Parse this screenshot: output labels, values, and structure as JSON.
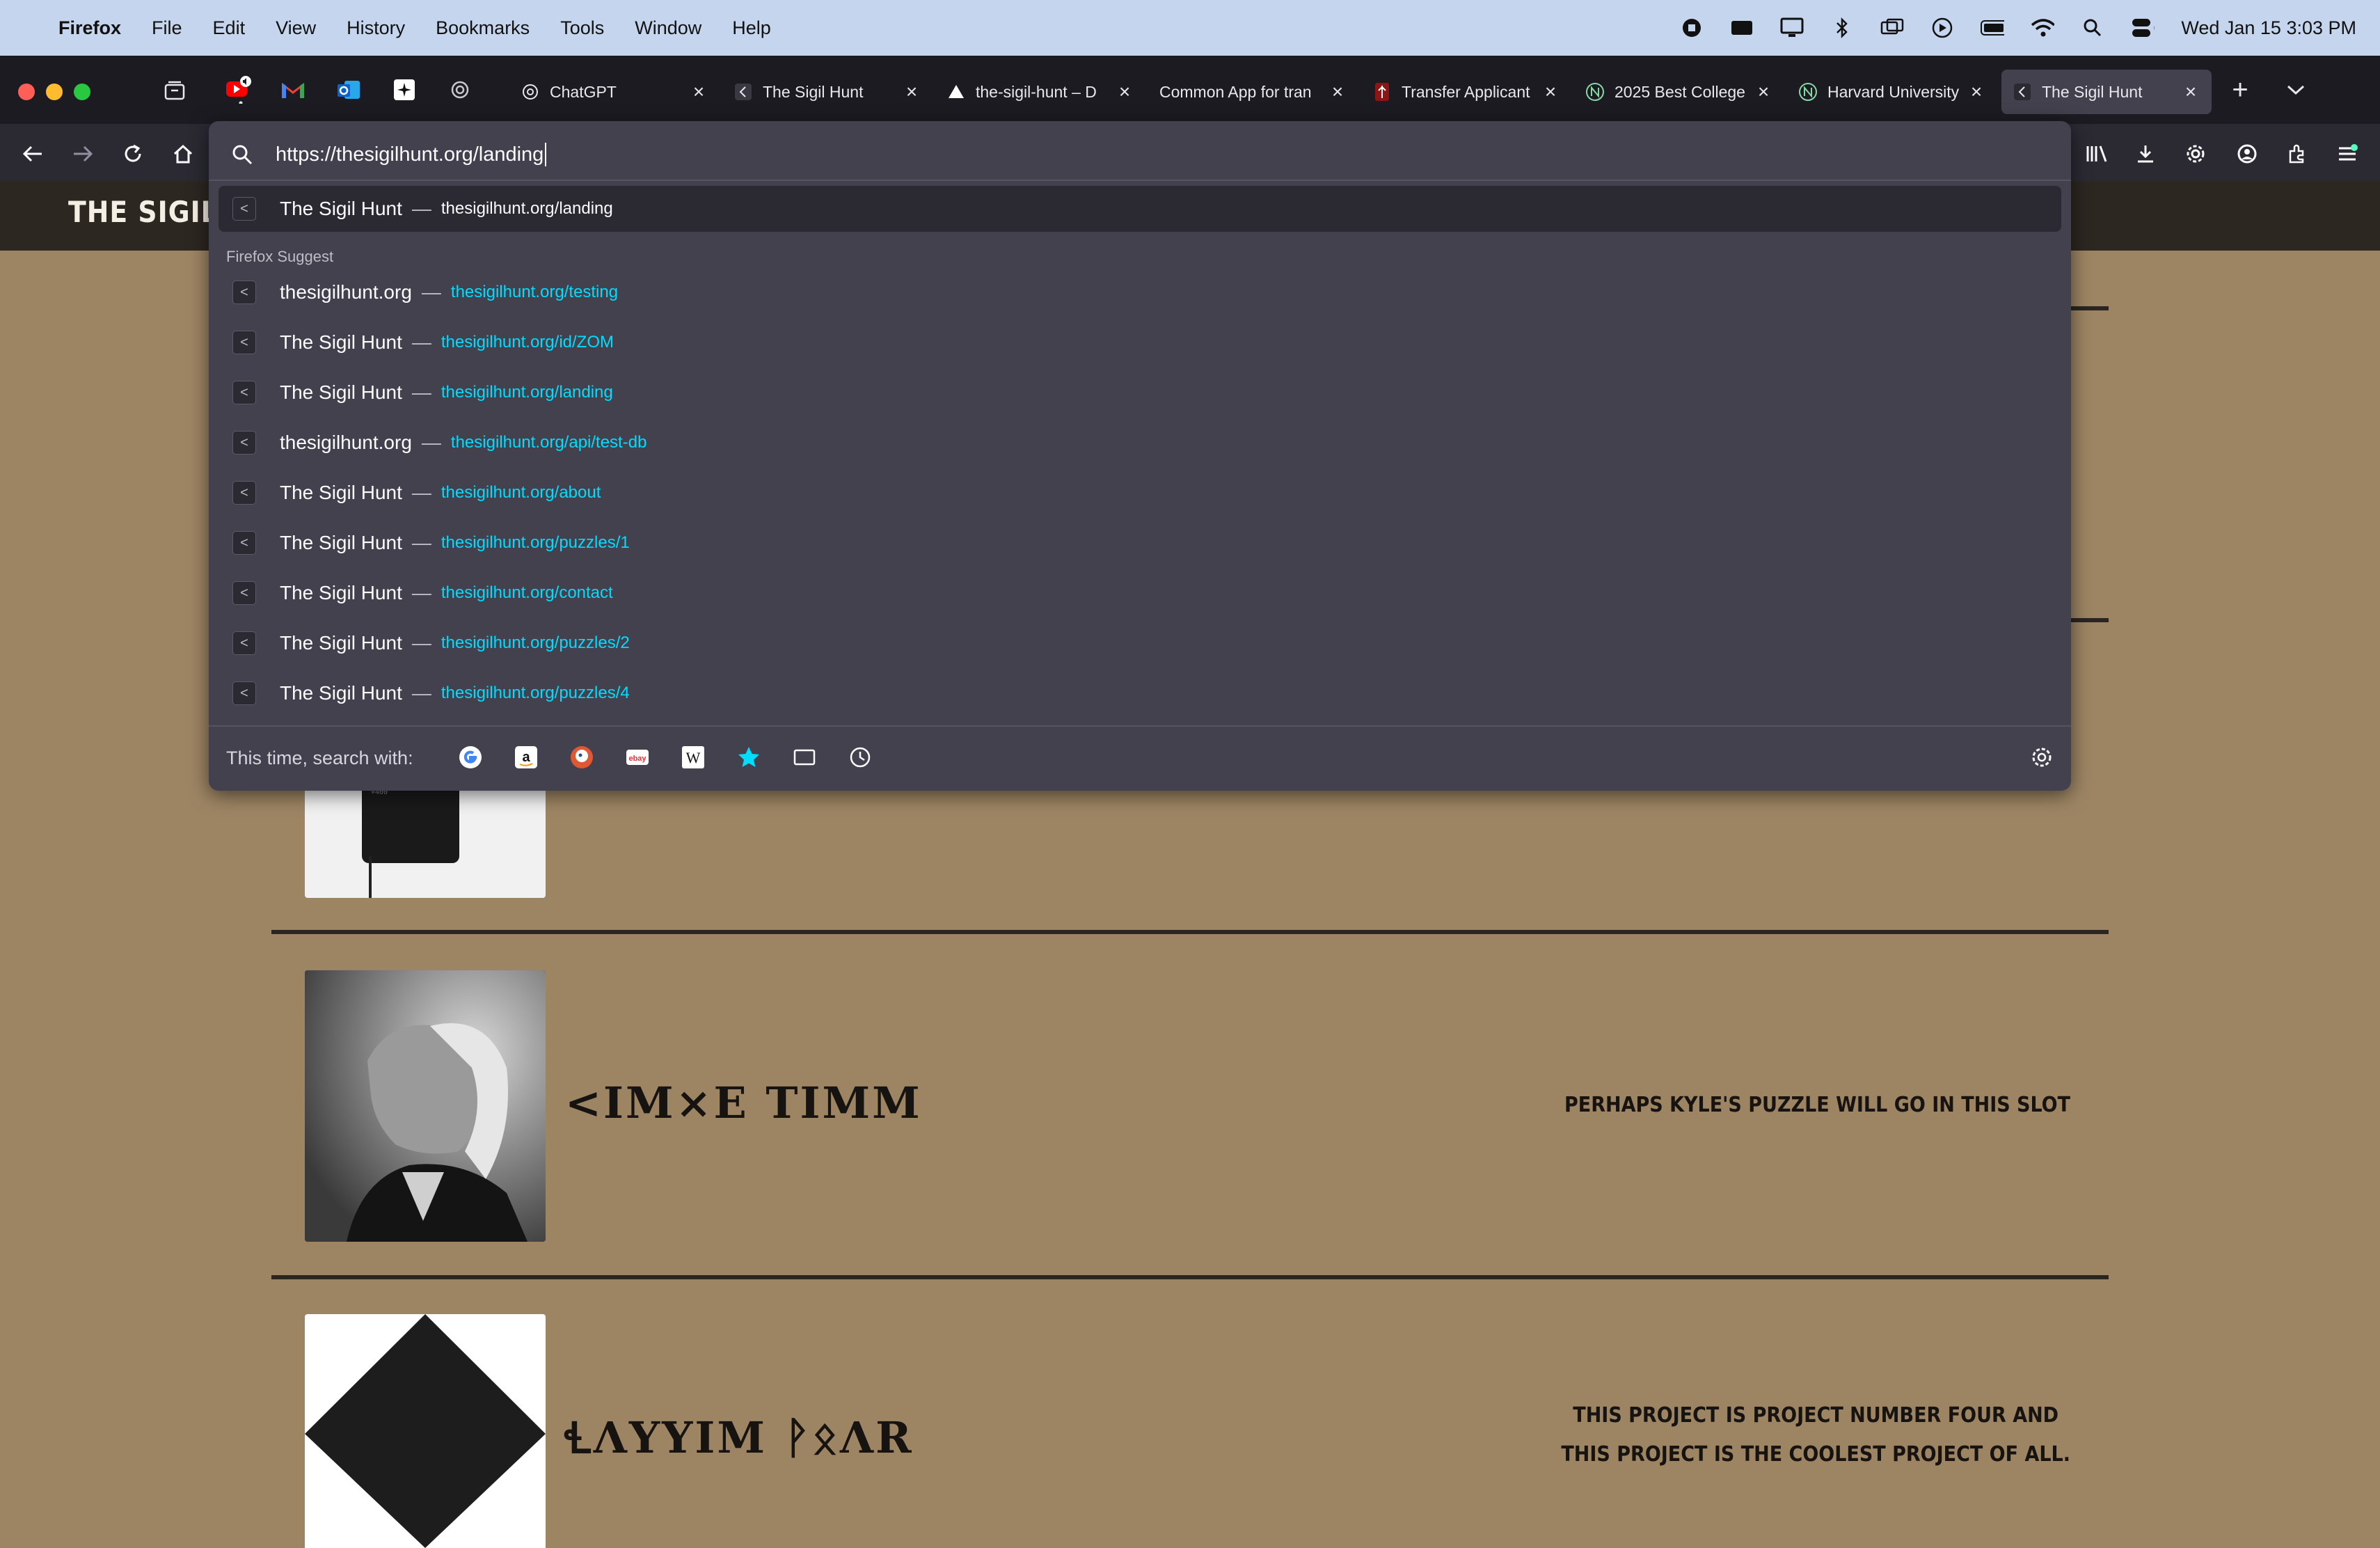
{
  "menubar": {
    "items": [
      "Firefox",
      "File",
      "Edit",
      "View",
      "History",
      "Bookmarks",
      "Tools",
      "Window",
      "Help"
    ],
    "clock": "Wed Jan 15  3:03 PM"
  },
  "tabs": [
    {
      "title": "ChatGPT",
      "icon": "chatgpt-icon"
    },
    {
      "title": "The Sigil Hunt",
      "icon": "sigil-icon"
    },
    {
      "title": "the-sigil-hunt – D",
      "icon": "vercel-icon"
    },
    {
      "title": "Common App for tran",
      "icon": "commonapp-icon"
    },
    {
      "title": "Transfer Applicant",
      "icon": "stanford-icon"
    },
    {
      "title": "2025 Best College",
      "icon": "niche-icon"
    },
    {
      "title": "Harvard University",
      "icon": "niche-icon"
    },
    {
      "title": "The Sigil Hunt",
      "icon": "sigil-icon"
    }
  ],
  "urlbar": {
    "value": "https://thesigilhunt.org/landing",
    "heuristic": {
      "title": "The Sigil Hunt",
      "url": "thesigilhunt.org/landing"
    },
    "section_label": "Firefox Suggest",
    "suggestions": [
      {
        "title": "thesigilhunt.org",
        "url": "thesigilhunt.org/testing"
      },
      {
        "title": "The Sigil Hunt",
        "url": "thesigilhunt.org/id/ZOM"
      },
      {
        "title": "The Sigil Hunt",
        "url": "thesigilhunt.org/landing"
      },
      {
        "title": "thesigilhunt.org",
        "url": "thesigilhunt.org/api/test-db"
      },
      {
        "title": "The Sigil Hunt",
        "url": "thesigilhunt.org/about"
      },
      {
        "title": "The Sigil Hunt",
        "url": "thesigilhunt.org/puzzles/1"
      },
      {
        "title": "The Sigil Hunt",
        "url": "thesigilhunt.org/contact"
      },
      {
        "title": "The Sigil Hunt",
        "url": "thesigilhunt.org/puzzles/2"
      },
      {
        "title": "The Sigil Hunt",
        "url": "thesigilhunt.org/puzzles/4"
      }
    ],
    "oneoff_label": "This time, search with:",
    "engines": [
      "google-icon",
      "amazon-icon",
      "duckduckgo-icon",
      "ebay-icon",
      "wikipedia-icon",
      "bookmarks-icon",
      "tabs-icon",
      "history-icon"
    ],
    "dash": "—"
  },
  "site": {
    "logo": "THE SIGIL HUI",
    "rows": [
      {
        "name": "<IM×E TIMM",
        "desc_lines": [
          "PERHAPS KYLE'S PUZZLE WILL GO IN THIS SLOT"
        ]
      },
      {
        "name": "ꞭΛYYIM ᚹᛟΛR",
        "desc_lines": [
          "THIS PROJECT IS PROJECT NUMBER FOUR AND",
          "THIS PROJECT IS THE COOLEST PROJECT OF ALL."
        ]
      }
    ]
  },
  "colors": {
    "accent": "#00ddff",
    "page_bg": "#9d8564",
    "panel": "#42414d"
  }
}
